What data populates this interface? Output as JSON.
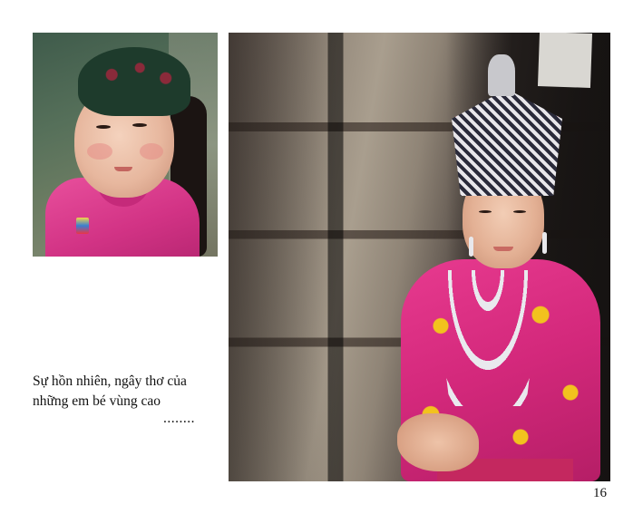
{
  "photos": {
    "small": {
      "alt": ""
    },
    "large": {
      "alt": ""
    }
  },
  "caption": {
    "line1": "Sự hồn nhiên, ngây thơ của",
    "line2": "những em bé vùng cao",
    "ellipsis": "........"
  },
  "page_number": "16"
}
